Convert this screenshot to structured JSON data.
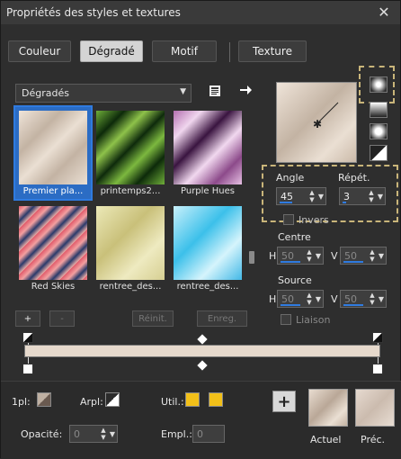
{
  "window": {
    "title": "Propriétés des styles et textures",
    "close_glyph": "✕"
  },
  "tabs": [
    {
      "label": "Couleur",
      "active": false
    },
    {
      "label": "Dégradé",
      "active": true
    },
    {
      "label": "Motif",
      "active": false
    },
    {
      "label": "Texture",
      "active": false
    }
  ],
  "gradient_list": {
    "dropdown_value": "Dégradés",
    "items": [
      {
        "label": "Premier pla...",
        "selected": true
      },
      {
        "label": "printemps2...",
        "selected": false
      },
      {
        "label": "Purple Hues",
        "selected": false
      },
      {
        "label": "Red Skies",
        "selected": false
      },
      {
        "label": "rentree_des...",
        "selected": false
      },
      {
        "label": "rentree_des...",
        "selected": false
      }
    ],
    "add_label": "+",
    "remove_label": "-",
    "reset_label": "Réinit.",
    "save_label": "Enreg."
  },
  "params": {
    "angle_label": "Angle",
    "angle_value": "45",
    "repeat_label": "Répét.",
    "repeat_value": "3",
    "invert_label": "Invers",
    "center_label": "Centre",
    "center_h_label": "H",
    "center_h_value": "50",
    "center_v_label": "V",
    "center_v_value": "50",
    "source_label": "Source",
    "source_h_label": "H",
    "source_h_value": "50",
    "source_v_label": "V",
    "source_v_value": "50",
    "link_label": "Liaison"
  },
  "bottom": {
    "first_plan_label": "1pl:",
    "background_label": "Arpl:",
    "util_label": "Util.:",
    "opacity_label": "Opacité:",
    "opacity_value": "0",
    "location_label": "Empl.:",
    "location_value": "0",
    "add_glyph": "+",
    "current_label": "Actuel",
    "previous_label": "Préc."
  },
  "colors": {
    "util_color_1": "#f2c019",
    "util_color_2": "#f2c019",
    "selection_blue": "#2f7be0",
    "highlight": "#c9b57a"
  }
}
